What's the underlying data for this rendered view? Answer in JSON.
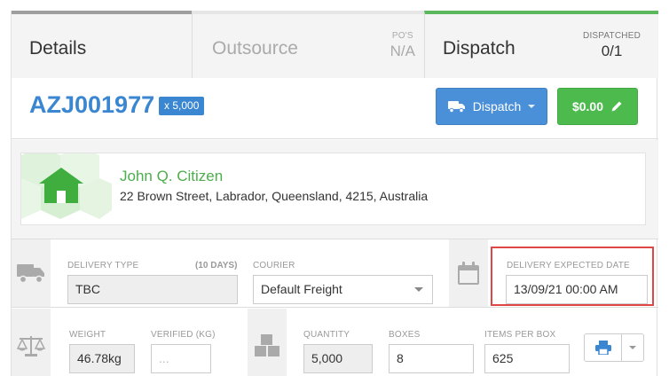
{
  "tabs": {
    "details": {
      "label": "Details"
    },
    "outsource": {
      "label": "Outsource",
      "meta_label": "PO'S",
      "meta_value": "N/A"
    },
    "dispatch": {
      "label": "Dispatch",
      "meta_label": "DISPATCHED",
      "meta_value": "0/1"
    }
  },
  "job": {
    "id": "AZJ001977",
    "quantity_badge": "x 5,000",
    "dispatch_button": "Dispatch",
    "price_button": "$0.00"
  },
  "address": {
    "name": "John Q. Citizen",
    "line": "22 Brown Street, Labrador, Queensland, 4215, Australia"
  },
  "delivery": {
    "type_label": "DELIVERY TYPE",
    "type_note": "(10 DAYS)",
    "type_value": "TBC",
    "courier_label": "COURIER",
    "courier_value": "Default Freight",
    "expected_label": "DELIVERY EXPECTED DATE",
    "expected_value": "13/09/21 00:00 AM"
  },
  "package": {
    "weight_label": "WEIGHT",
    "weight_value": "46.78kg",
    "verified_label": "VERIFIED (KG)",
    "verified_placeholder": "...",
    "quantity_label": "QUANTITY",
    "quantity_value": "5,000",
    "boxes_label": "BOXES",
    "boxes_value": "8",
    "items_label": "ITEMS PER BOX",
    "items_value": "625"
  },
  "colors": {
    "accent_blue": "#3a86d1",
    "success_green": "#4cba4c",
    "highlight_red": "#e04646"
  },
  "icons": [
    "truck-icon",
    "caret-down-icon",
    "pencil-icon",
    "house-icon",
    "delivery-truck-icon",
    "calendar-icon",
    "scale-icon",
    "boxes-icon",
    "printer-icon"
  ]
}
